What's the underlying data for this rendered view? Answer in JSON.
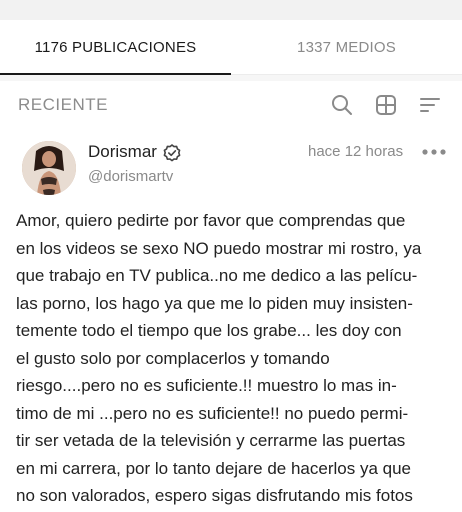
{
  "tabs": {
    "posts_label": "1176 PUBLICACIONES",
    "media_label": "1337 MEDIOS"
  },
  "section": {
    "title": "RECIENTE",
    "icons": [
      "search-icon",
      "grid-icon",
      "sort-icon"
    ]
  },
  "post": {
    "author_name": "Dorismar",
    "author_handle": "@dorismartv",
    "time": "hace 12 horas",
    "verified": true,
    "text_lines": [
      "Amor, quiero pedirte por favor que comprendas que",
      "en los videos se sexo NO puedo mostrar mi rostro, ya",
      "que trabajo en TV publica..no me dedico a las pelícu-",
      "las porno, los hago ya que me lo piden muy insisten-",
      "temente todo el tiempo que los grabe... les doy con",
      "el gusto solo por complacerlos y tomando",
      "riesgo....pero no es suficiente.!! muestro lo mas in-",
      "timo de mi ...pero no es suficiente!! no puedo permi-",
      "tir ser vetada de la televisión y cerrarme las puertas",
      "en mi carrera, por lo tanto dejare de hacerlos ya que",
      "no son valorados, espero sigas disfrutando mis fotos"
    ]
  },
  "colors": {
    "active_tab": "#1a1a1a",
    "muted": "#8a8a8a",
    "text": "#222222",
    "background": "#ffffff"
  }
}
